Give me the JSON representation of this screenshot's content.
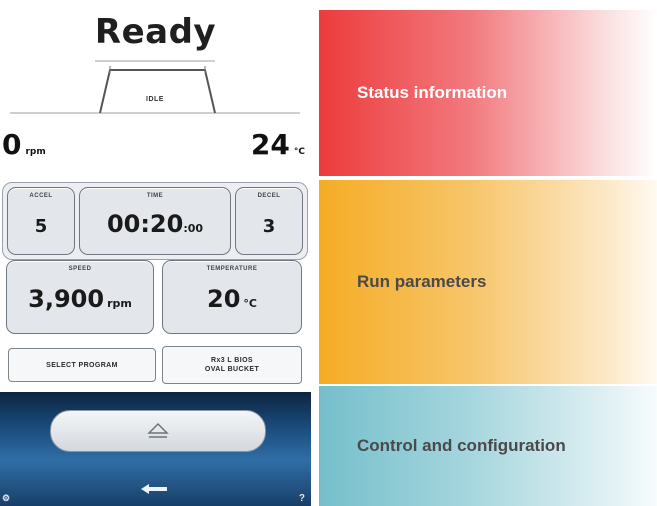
{
  "status": {
    "title": "Ready",
    "profile_label": "IDLE",
    "speed": {
      "value": "0",
      "unit": "rpm"
    },
    "temperature": {
      "value": "24",
      "unit": "°C"
    }
  },
  "run_parameters": {
    "accel": {
      "label": "ACCEL",
      "value": "5"
    },
    "time": {
      "label": "TIME",
      "value_main": "00:20",
      "value_seconds": ":00"
    },
    "decel": {
      "label": "DECEL",
      "value": "3"
    },
    "speed": {
      "label": "SPEED",
      "value": "3,900",
      "unit": "rpm"
    },
    "temperature": {
      "label": "TEMPERATURE",
      "value": "20",
      "unit": "°C"
    },
    "select_program": "SELECT PROGRAM",
    "rotor_line1": "Rx3 L BIOS",
    "rotor_line2": "OVAL BUCKET"
  },
  "control": {
    "left_glyph": "⚙",
    "help_glyph": "?"
  },
  "legend": {
    "status": "Status information",
    "run": "Run parameters",
    "control": "Control and configuration"
  },
  "colors": {
    "status_band": "#ec3b3c",
    "run_band": "#f5ac24",
    "control_band": "#75bfcb",
    "control_strip": "#1a4a7a"
  }
}
